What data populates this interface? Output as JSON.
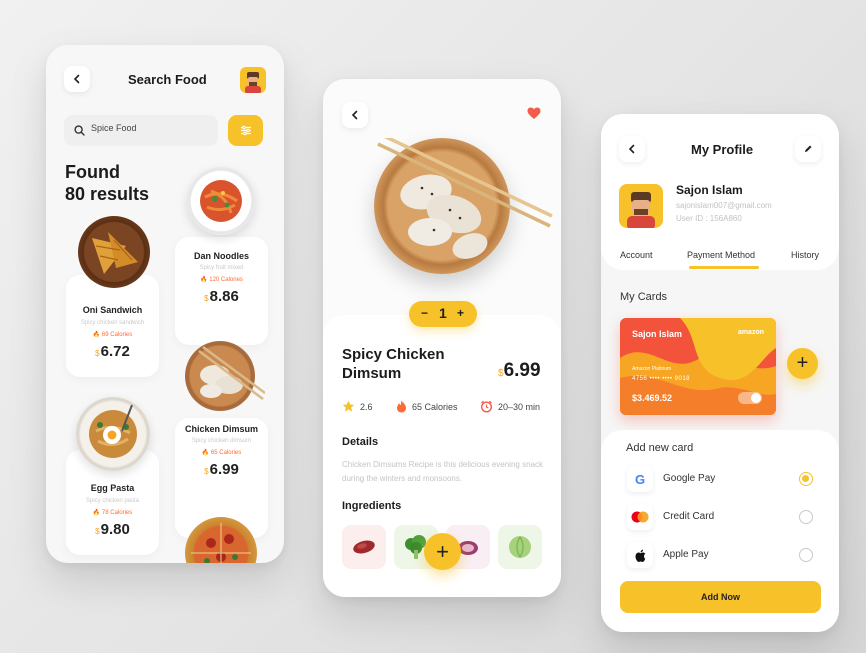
{
  "search_screen": {
    "title": "Search Food",
    "search_value": "Spice Food",
    "found_line1": "Found",
    "found_line2": "80 results",
    "items": [
      {
        "name": "Oni Sandwich",
        "sub": "Spicy chicken sandwich",
        "calories": "69 Calories",
        "currency": "$",
        "price": "6.72"
      },
      {
        "name": "Dan Noodles",
        "sub": "Spicy fruit mixed",
        "calories": "120 Calories",
        "currency": "$",
        "price": "8.86"
      },
      {
        "name": "Egg Pasta",
        "sub": "Spicy chicken pasta",
        "calories": "78 Calories",
        "currency": "$",
        "price": "9.80"
      },
      {
        "name": "Chicken Dimsum",
        "sub": "Spicy chicken dimsum",
        "calories": "65 Calories",
        "currency": "$",
        "price": "6.99"
      }
    ]
  },
  "detail_screen": {
    "quantity": "1",
    "minus": "−",
    "plus": "+",
    "title_line1": "Spicy Chicken",
    "title_line2": "Dimsum",
    "currency": "$",
    "price": "6.99",
    "rating": "2.6",
    "calories": "65 Calories",
    "time": "20–30 min",
    "details_heading": "Details",
    "details_text": "Chicken Dimsums Recipe is this delicious evening snack during the winters and monsoons.",
    "ingredients_heading": "Ingredients",
    "add_symbol": "+"
  },
  "profile_screen": {
    "title": "My Profile",
    "user_name": "Sajon Islam",
    "user_email": "sajonislam007@gmail.com",
    "user_id": "User ID : 156A860",
    "tabs": [
      "Account",
      "Payment Method",
      "History"
    ],
    "active_tab": "Payment Method",
    "my_cards_heading": "My Cards",
    "card": {
      "holder": "Sajon Islam",
      "brand": "amazon",
      "card_type": "Amazon Platinum",
      "number": "4756  ••••  ••••  9018",
      "balance": "$3.469.52"
    },
    "add_symbol": "+",
    "add_new_card_heading": "Add new card",
    "payment_options": [
      {
        "label": "Google Pay",
        "icon": "google-icon",
        "selected": true
      },
      {
        "label": "Credit Card",
        "icon": "mastercard-icon",
        "selected": false
      },
      {
        "label": "Apple Pay",
        "icon": "apple-icon",
        "selected": false
      }
    ],
    "add_now_label": "Add Now"
  },
  "colors": {
    "accent_yellow": "#f7c229",
    "accent_orange": "#ff6b35",
    "card_red": "#f2533a",
    "heart_red": "#f25c4a"
  }
}
